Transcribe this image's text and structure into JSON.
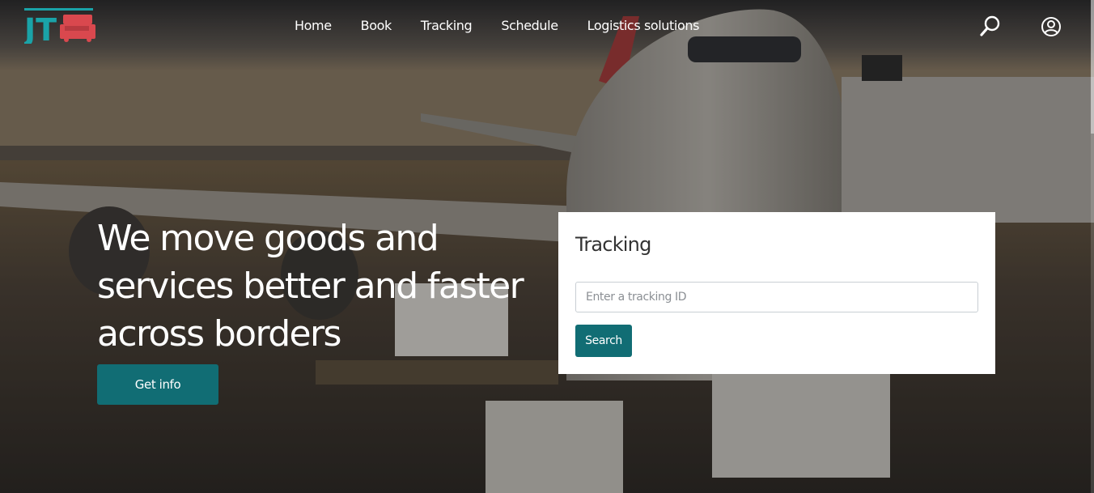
{
  "colors": {
    "accent": "#116d74",
    "logo_teal": "#1aa3a8",
    "logo_red": "#d9484e",
    "card_bg": "#ffffff"
  },
  "brand": {
    "logo_text": "JT",
    "logo_icon": "truck-icon"
  },
  "nav": {
    "items": [
      {
        "label": "Home"
      },
      {
        "label": "Book"
      },
      {
        "label": "Tracking"
      },
      {
        "label": "Schedule"
      },
      {
        "label": "Logistics solutions"
      }
    ]
  },
  "header_icons": {
    "search": "search-icon",
    "account": "user-circle-icon"
  },
  "hero": {
    "headline": "We move goods and services better and faster across borders",
    "cta_label": "Get info"
  },
  "tracking": {
    "title": "Tracking",
    "input_placeholder": "Enter a tracking ID",
    "input_value": "",
    "submit_label": "Search"
  }
}
